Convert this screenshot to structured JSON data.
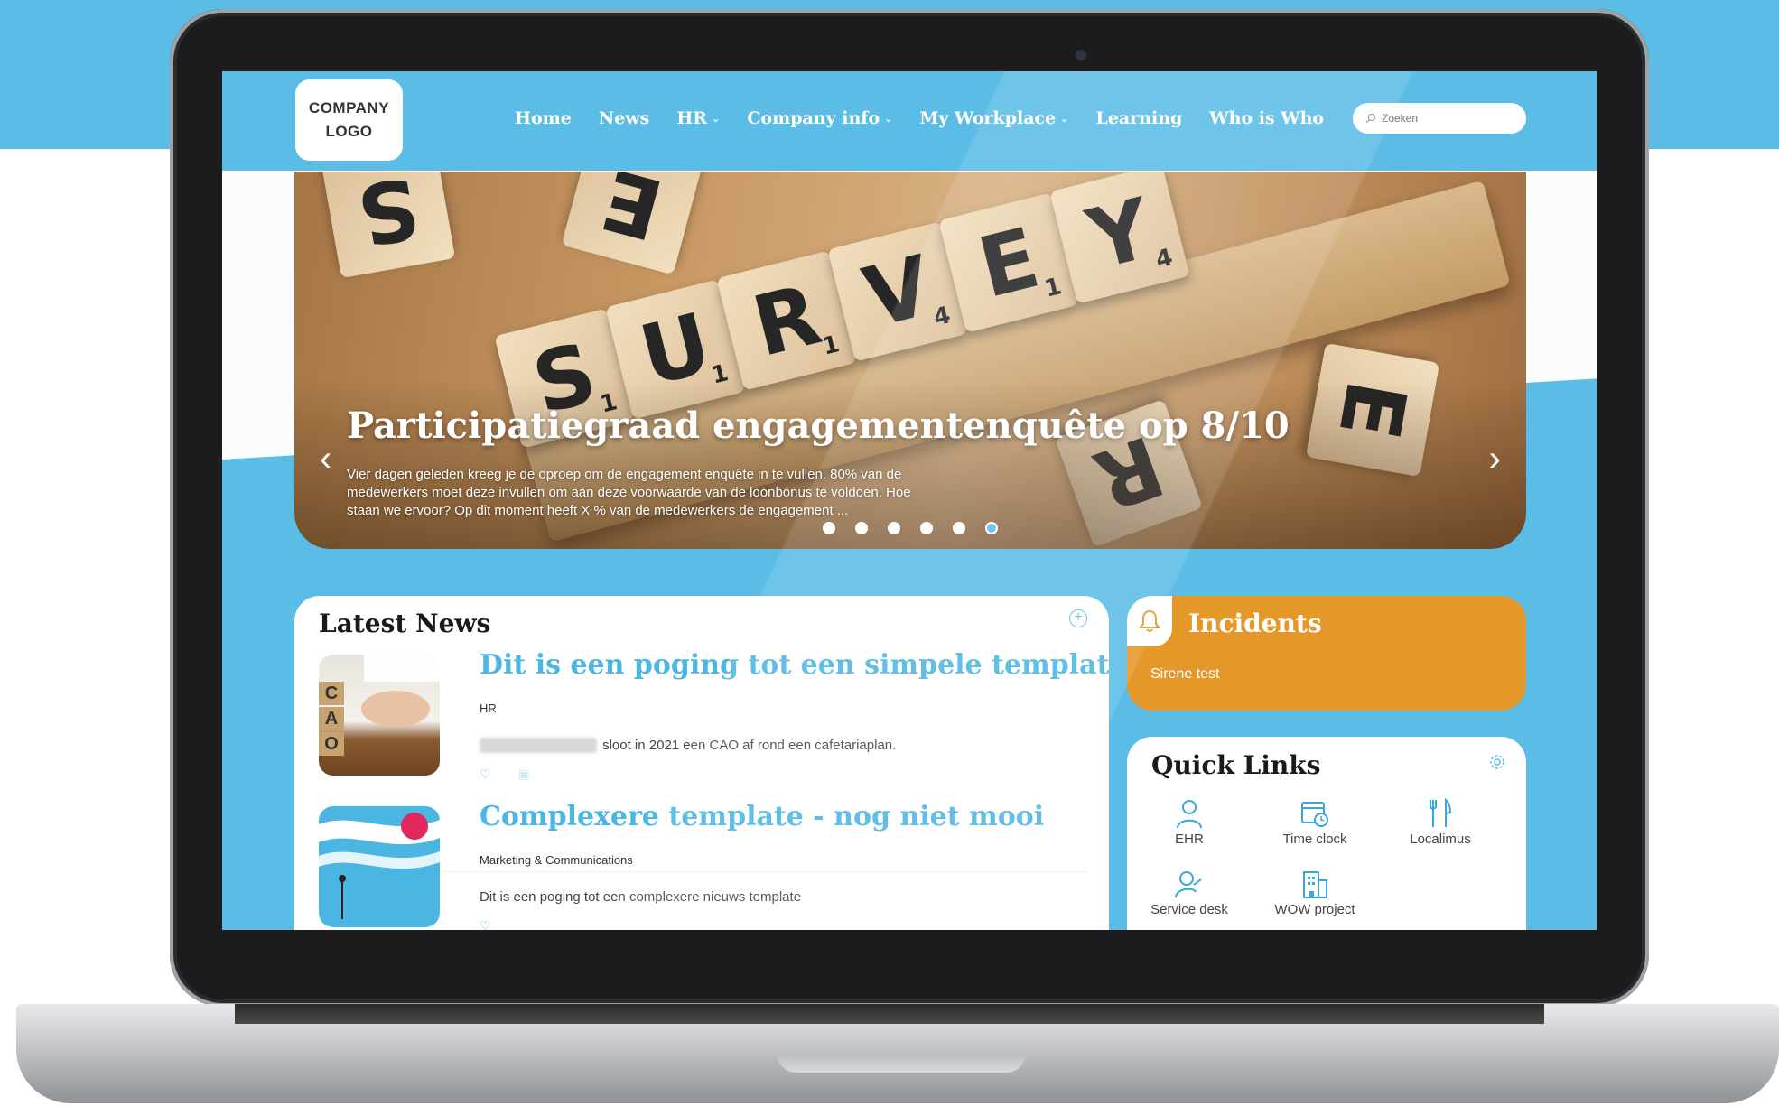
{
  "header": {
    "logo_text_1": "COMPANY",
    "logo_text_2": "LOGO",
    "nav": [
      {
        "label": "Home",
        "dropdown": false
      },
      {
        "label": "News",
        "dropdown": false
      },
      {
        "label": "HR",
        "dropdown": true
      },
      {
        "label": "Company info",
        "dropdown": true
      },
      {
        "label": "My Workplace",
        "dropdown": true
      },
      {
        "label": "Learning",
        "dropdown": false
      },
      {
        "label": "Who is Who",
        "dropdown": false
      }
    ],
    "search_placeholder": "Zoeken"
  },
  "hero": {
    "tiles": [
      "S",
      "U",
      "R",
      "V",
      "E",
      "Y",
      "E",
      "R",
      "S",
      "E"
    ],
    "tile_scores": [
      "1",
      "1",
      "1",
      "4",
      "1",
      "4",
      "1",
      "1"
    ],
    "title": "Participatiegraad engagementenquête op 8/10",
    "text": "Vier dagen geleden kreeg je de oproep om de engagement enquête in te vullen. 80% van de medewerkers moet deze invullen om aan deze voorwaarde van de loonbonus te voldoen. Hoe staan we ervoor? Op dit moment heeft X % van de medewerkers de engagement ...",
    "slides": 6,
    "active_slide": 6
  },
  "latest_news": {
    "title": "Latest News",
    "items": [
      {
        "title": "Dit is een poging tot een simpele template",
        "category": "HR",
        "body": "sloot in 2021 een CAO af rond een cafetariaplan.",
        "thumb_letters": [
          "C",
          "A",
          "O"
        ]
      },
      {
        "title": "Complexere template - nog niet mooi",
        "category": "Marketing & Communications",
        "body": "Dit is een poging tot een complexere nieuws template"
      }
    ]
  },
  "incidents": {
    "title": "Incidents",
    "items": [
      "Sirene test"
    ]
  },
  "quick_links": {
    "title": "Quick Links",
    "items": [
      {
        "label": "EHR",
        "icon": "person-icon"
      },
      {
        "label": "Time clock",
        "icon": "calendar-clock-icon"
      },
      {
        "label": "Localimus",
        "icon": "fork-knife-icon"
      },
      {
        "label": "Service desk",
        "icon": "support-icon"
      },
      {
        "label": "WOW project",
        "icon": "building-icon"
      }
    ]
  },
  "colors": {
    "brand": "#5bbde6",
    "incident": "#e5982a",
    "headline": "#4ab6e4"
  }
}
